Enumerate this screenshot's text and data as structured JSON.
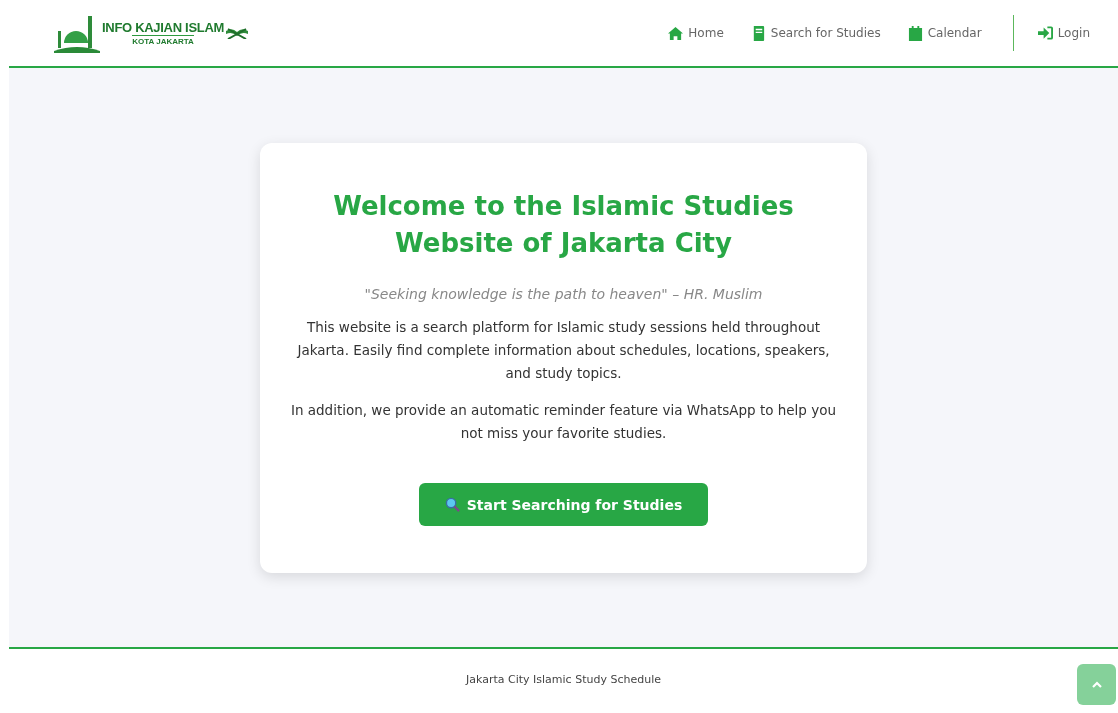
{
  "logo": {
    "title": "INFO KAJIAN ISLAM",
    "subtitle": "KOTA JAKARTA"
  },
  "nav": [
    {
      "label": "Home"
    },
    {
      "label": "Search for Studies"
    },
    {
      "label": "Calendar"
    }
  ],
  "login": {
    "label": "Login"
  },
  "hero": {
    "title": "Welcome to the Islamic Studies Website of Jakarta City",
    "quote": "\"Seeking knowledge is the path to heaven\" – HR. Muslim",
    "paragraphs": [
      "This website is a search platform for Islamic study sessions held throughout Jakarta. Easily find complete information about schedules, locations, speakers, and study topics.",
      "In addition, we provide an automatic reminder feature via WhatsApp to help you not miss your favorite studies."
    ],
    "button": "Start Searching for Studies"
  },
  "footer": {
    "text": "Jakarta City Islamic Study Schedule"
  }
}
